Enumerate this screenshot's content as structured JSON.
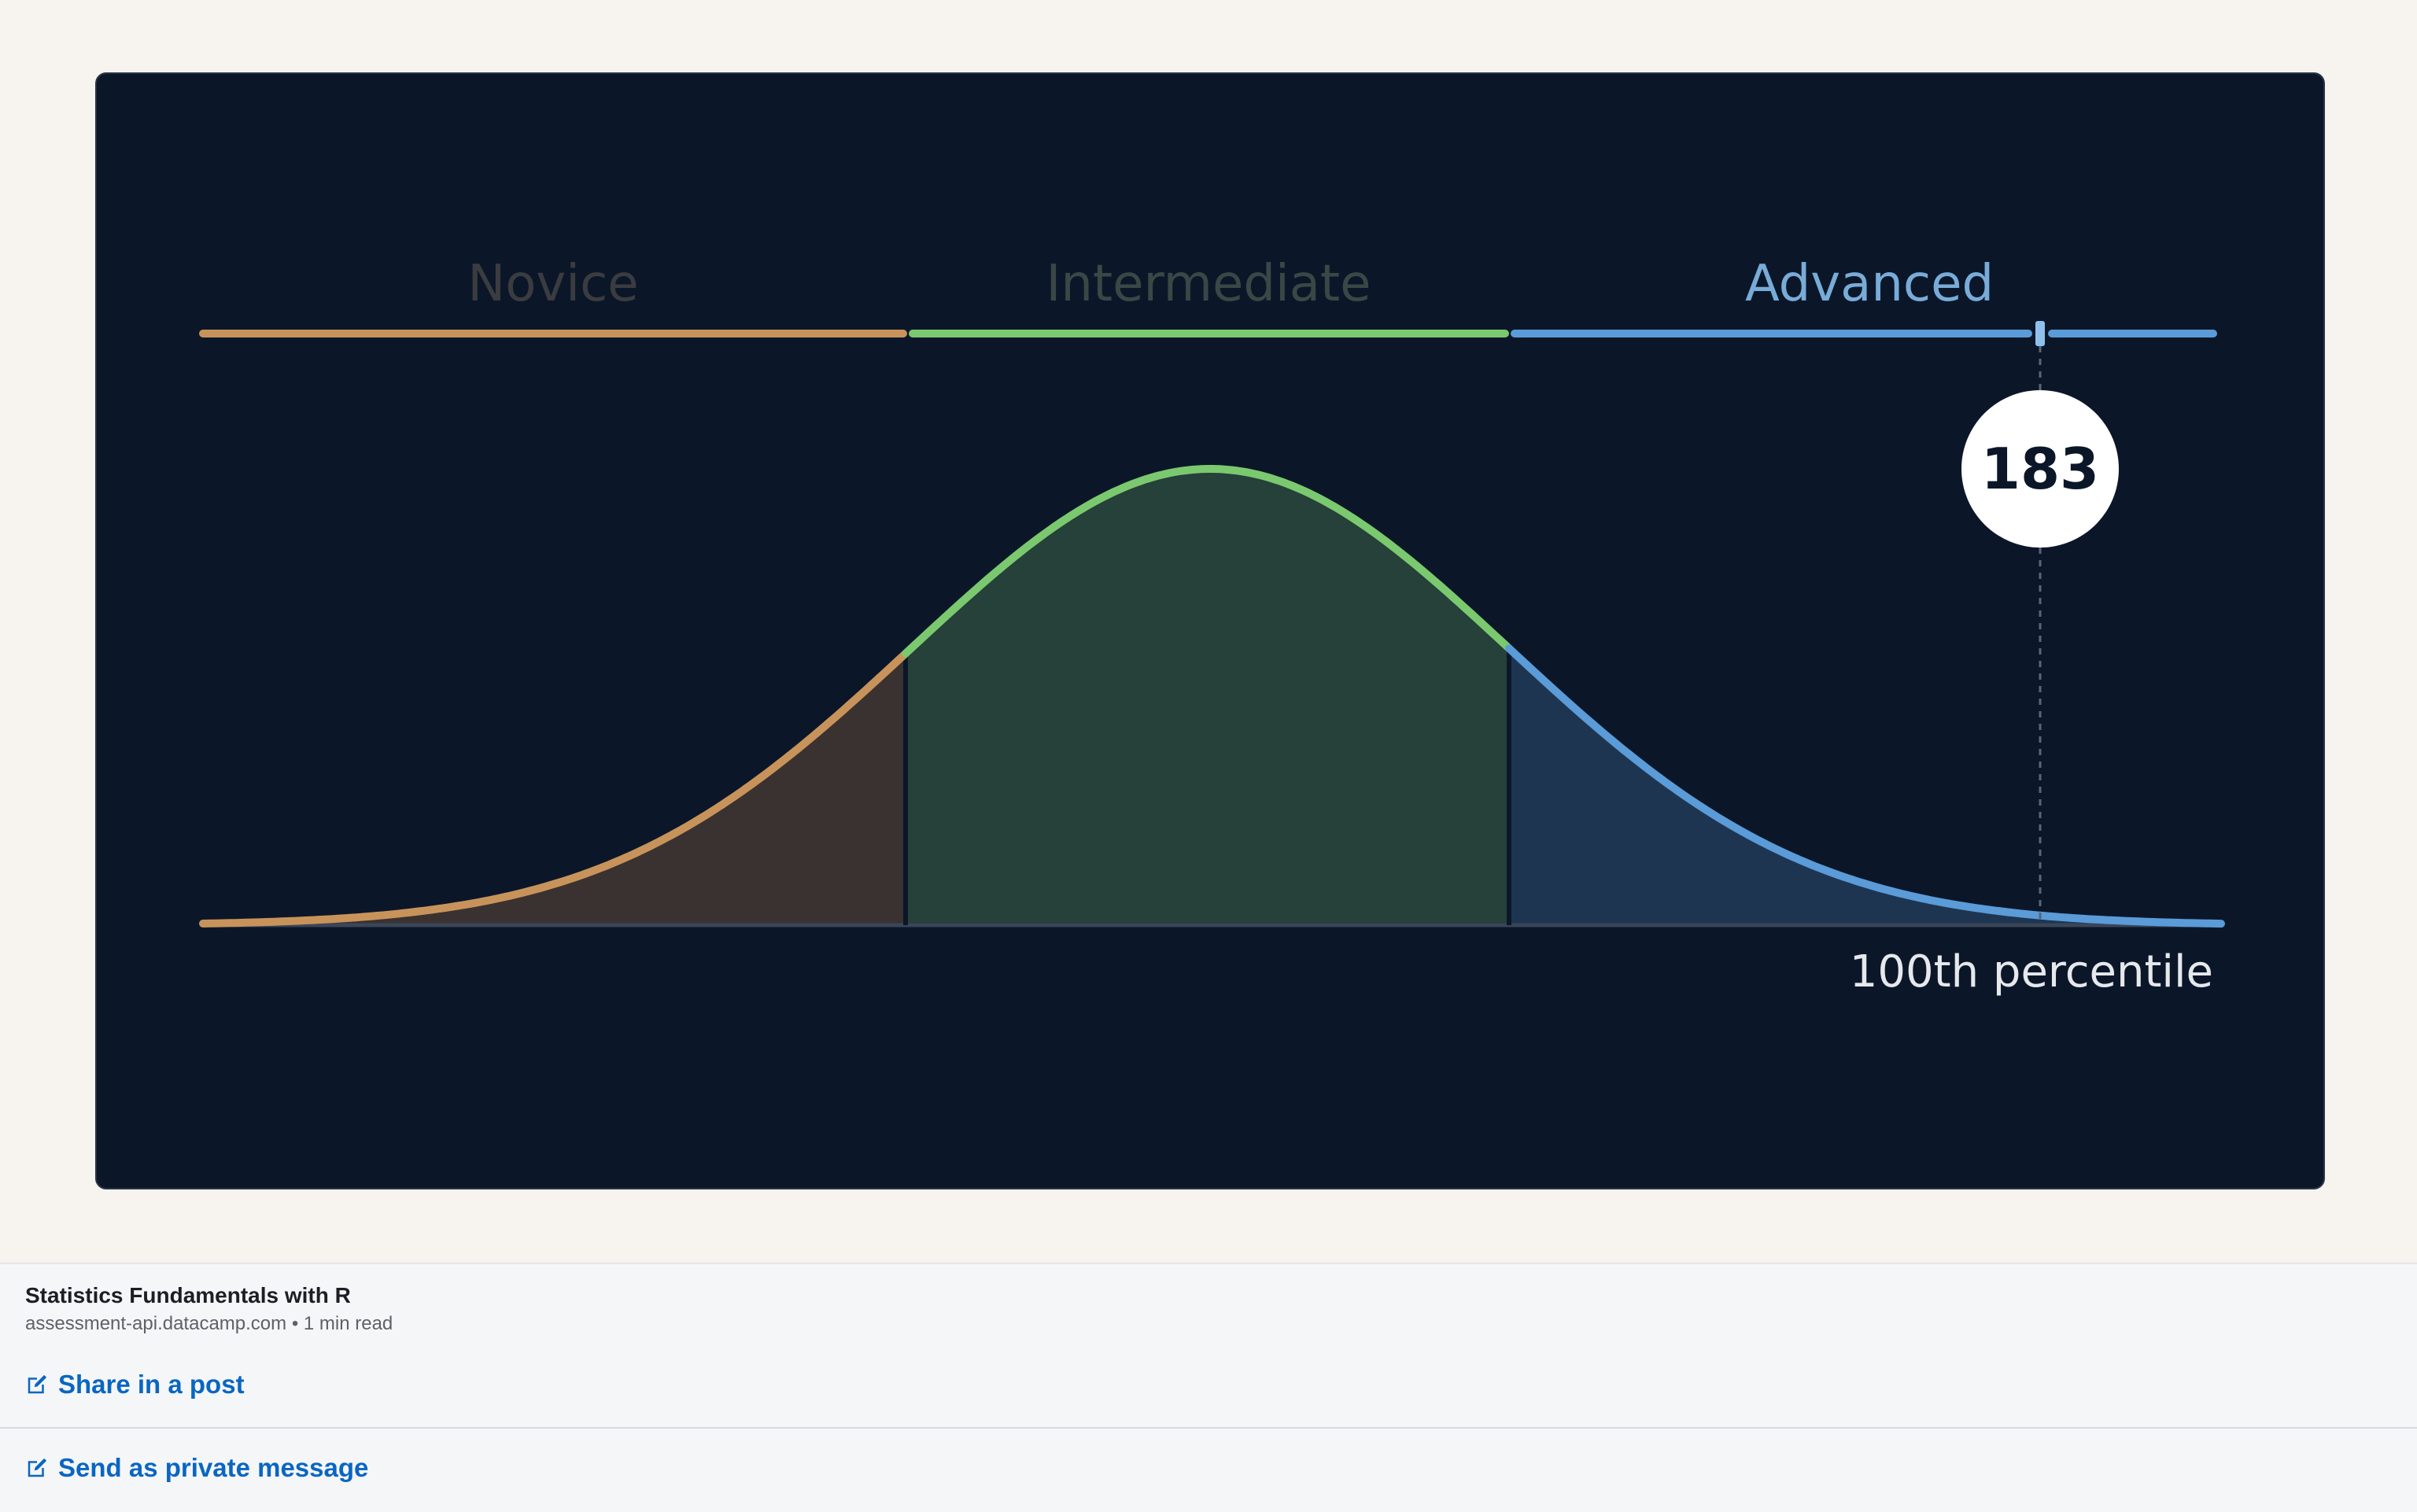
{
  "hero": {
    "levels": [
      {
        "label": "Novice",
        "color": "#c8935a",
        "text_color": "#3b3c40",
        "fill": "#3a3231"
      },
      {
        "label": "Intermediate",
        "color": "#7bc96f",
        "text_color": "#3b4745",
        "fill": "#26403a"
      },
      {
        "label": "Advanced",
        "color": "#5a9bd8",
        "text_color": "#79abd8",
        "fill": "#1e3551"
      }
    ],
    "score": "183",
    "percentile_label": "100th percentile"
  },
  "link": {
    "title": "Statistics Fundamentals with R",
    "source": "assessment-api.datacamp.com • 1 min read"
  },
  "actions": {
    "share_label": "Share in a post",
    "send_label": "Send as private message"
  },
  "colors": {
    "link_blue": "#0a66c2",
    "panel_bg": "#0b1729",
    "page_bg": "#f7f3ee"
  }
}
